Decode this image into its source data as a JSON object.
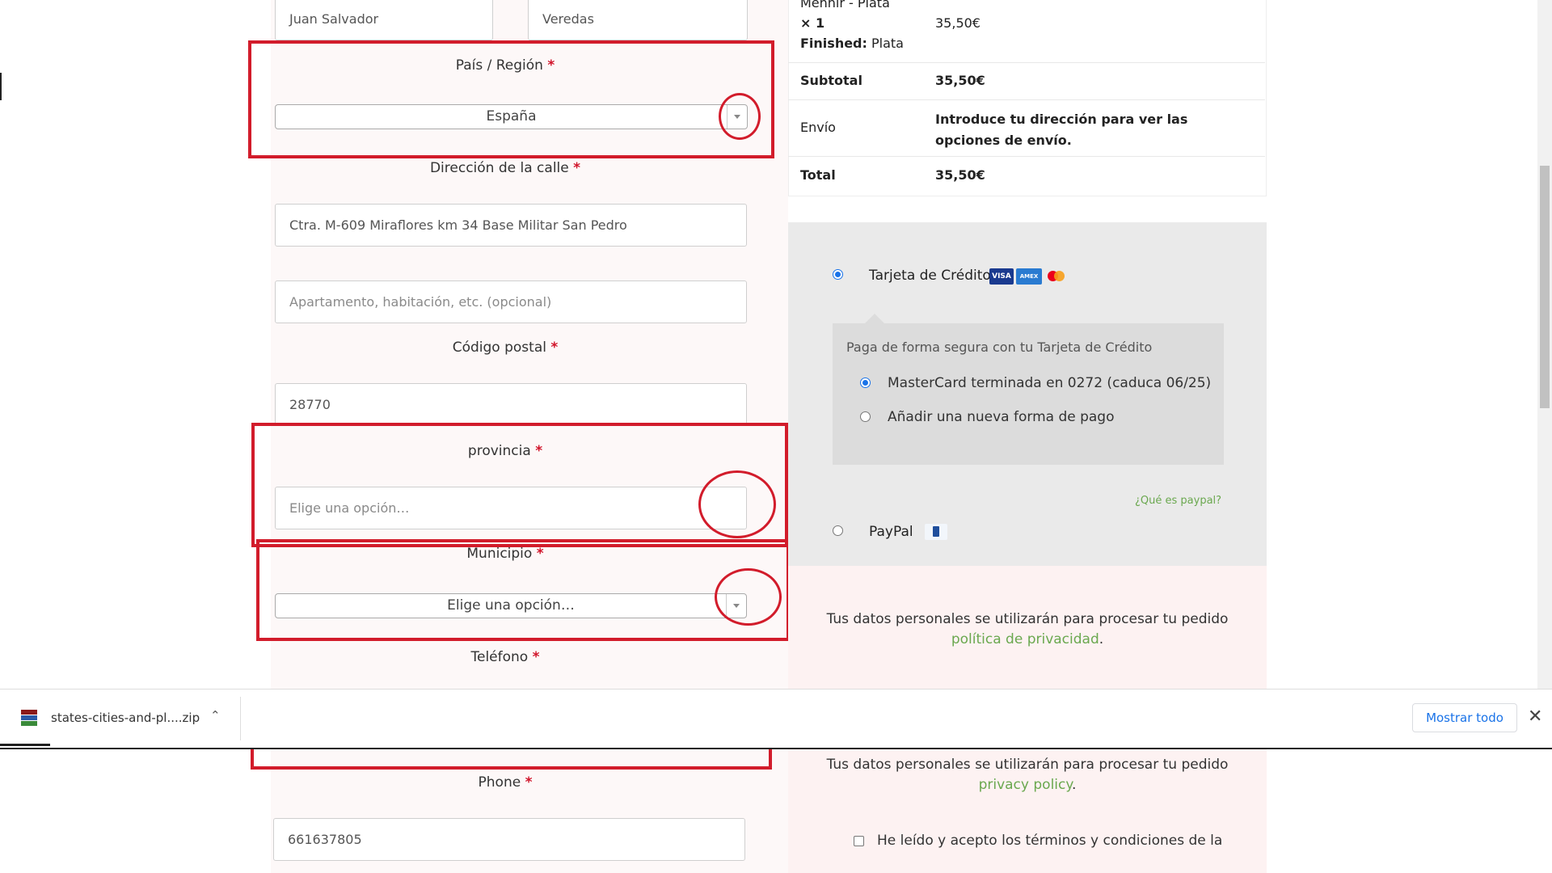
{
  "form": {
    "first_name_value": "Juan Salvador",
    "last_name_value": "Veredas",
    "country_label": "País / Región",
    "country_value": "España",
    "street_label": "Dirección de la calle",
    "street_value": "Ctra. M-609 Miraflores km 34 Base Militar San Pedro",
    "apartment_placeholder": "Apartamento, habitación, etc. (opcional)",
    "postal_label": "Código postal",
    "postal_value": "28770",
    "province_label": "provincia",
    "province_placeholder": "Elige una opción…",
    "municipality_label": "Municipio",
    "municipality_value": "Elige una opción…",
    "phone_label_es": "Teléfono",
    "phone_label_en": "Phone",
    "phone_value": "661637805",
    "required_mark": "*"
  },
  "order": {
    "product_line1": "Menhir - Plata",
    "product_qty": "× 1",
    "product_attr_label": "Finished:",
    "product_attr_value": "Plata",
    "product_price": "35,50€",
    "subtotal_label": "Subtotal",
    "subtotal_value": "35,50€",
    "shipping_label": "Envío",
    "shipping_value": "Introduce tu dirección para ver las opciones de envío.",
    "total_label": "Total",
    "total_value": "35,50€"
  },
  "payment": {
    "credit_card_label": "Tarjeta de Crédito",
    "card_logos": [
      "VISA",
      "AMEX",
      "MC"
    ],
    "secure_text": "Paga de forma segura con tu Tarjeta de Crédito",
    "saved_card": "MasterCard terminada en 0272 (caduca 06/25)",
    "new_method": "Añadir una nueva forma de pago",
    "paypal_help": "¿Qué es paypal?",
    "paypal_label": "PayPal"
  },
  "privacy": {
    "es_text": "Tus datos personales se utilizarán para procesar tu pedido",
    "es_link": "política de privacidad",
    "en_text": "Tus datos personales se utilizarán para procesar tu pedido",
    "en_link": "privacy policy",
    "period": ".",
    "terms_text": "He leído y acepto los términos y condiciones de la"
  },
  "download_bar": {
    "file_name": "states-cities-and-pl....zip",
    "show_all": "Mostrar todo"
  },
  "colors": {
    "annotation_red": "#d21c2b",
    "link_green": "#6aa84f",
    "chrome_blue": "#1a73e8"
  }
}
